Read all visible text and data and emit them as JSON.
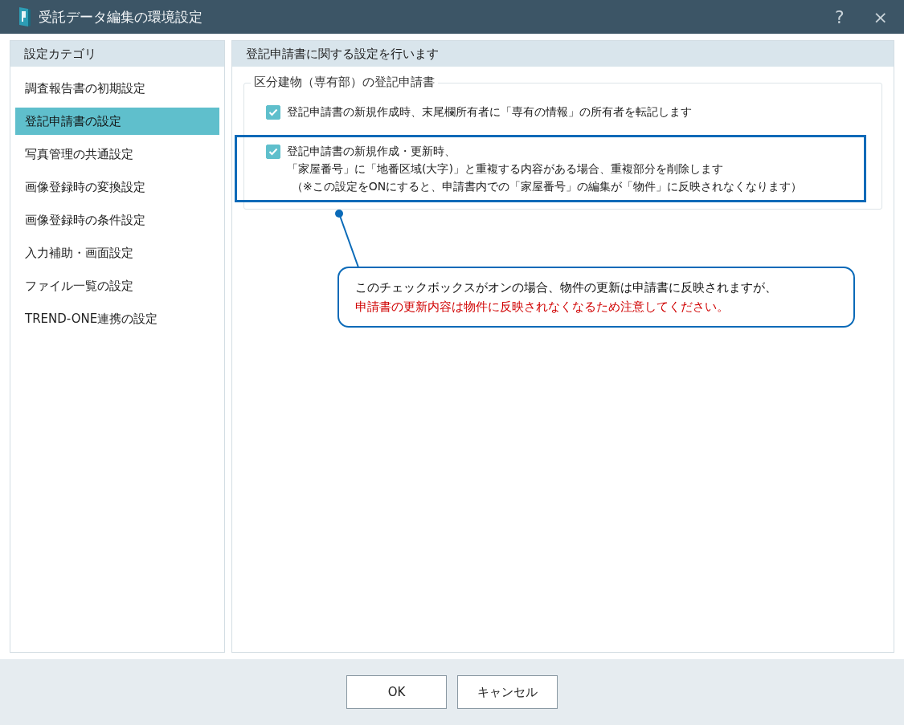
{
  "window": {
    "title": "受託データ編集の環境設定",
    "help": "?",
    "close": "×"
  },
  "sidebar": {
    "title": "設定カテゴリ",
    "items": [
      {
        "label": "調査報告書の初期設定",
        "selected": false
      },
      {
        "label": "登記申請書の設定",
        "selected": true
      },
      {
        "label": "写真管理の共通設定",
        "selected": false
      },
      {
        "label": "画像登録時の変換設定",
        "selected": false
      },
      {
        "label": "画像登録時の条件設定",
        "selected": false
      },
      {
        "label": "入力補助・画面設定",
        "selected": false
      },
      {
        "label": "ファイル一覧の設定",
        "selected": false
      },
      {
        "label": "TREND-ONE連携の設定",
        "selected": false
      }
    ]
  },
  "content": {
    "title": "登記申請書に関する設定を行います",
    "group": {
      "title": "区分建物（専有部）の登記申請書",
      "options": [
        {
          "lines": [
            "登記申請書の新規作成時、末尾欄所有者に「専有の情報」の所有者を転記します"
          ],
          "checked": true,
          "highlighted": false
        },
        {
          "lines": [
            "登記申請書の新規作成・更新時、",
            "「家屋番号」に「地番区域(大字)」と重複する内容がある場合、重複部分を削除します"
          ],
          "note": "（※この設定をONにすると、申請書内での「家屋番号」の編集が「物件」に反映されなくなります）",
          "checked": true,
          "highlighted": true
        }
      ]
    }
  },
  "callout": {
    "lines": [
      {
        "text": "このチェックボックスがオンの場合、物件の更新は申請書に反映されますが、",
        "warning": false
      },
      {
        "text": "申請書の更新内容は物件に反映されなくなるため注意してください。",
        "warning": true
      }
    ]
  },
  "buttons": [
    "OK",
    "キャンセル"
  ]
}
